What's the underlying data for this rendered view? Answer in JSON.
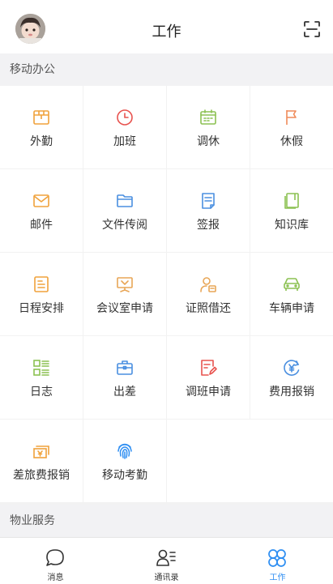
{
  "header": {
    "title": "工作",
    "avatar_icon": "child-avatar",
    "scan_icon": "scan-icon"
  },
  "sections": {
    "mobile_office": "移动办公",
    "property_service": "物业服务"
  },
  "tiles": [
    {
      "label": "外勤",
      "icon": "field-work-icon",
      "color": "#f0a23b"
    },
    {
      "label": "加班",
      "icon": "clock-icon",
      "color": "#e8534f"
    },
    {
      "label": "调休",
      "icon": "calendar-icon",
      "color": "#8cc152"
    },
    {
      "label": "休假",
      "icon": "flag-icon",
      "color": "#ef8a5a"
    },
    {
      "label": "邮件",
      "icon": "mail-icon",
      "color": "#f0a23b"
    },
    {
      "label": "文件传阅",
      "icon": "folder-icon",
      "color": "#4a8fe0"
    },
    {
      "label": "签报",
      "icon": "document-icon",
      "color": "#4a8fe0"
    },
    {
      "label": "知识库",
      "icon": "book-icon",
      "color": "#8cc152"
    },
    {
      "label": "日程安排",
      "icon": "schedule-icon",
      "color": "#f0a23b"
    },
    {
      "label": "会议室申请",
      "icon": "presentation-icon",
      "color": "#e8a657"
    },
    {
      "label": "证照借还",
      "icon": "id-card-icon",
      "color": "#e8a657"
    },
    {
      "label": "车辆申请",
      "icon": "car-icon",
      "color": "#8cc152"
    },
    {
      "label": "日志",
      "icon": "log-grid-icon",
      "color": "#8cc152"
    },
    {
      "label": "出差",
      "icon": "briefcase-icon",
      "color": "#4a8fe0"
    },
    {
      "label": "调班申请",
      "icon": "edit-form-icon",
      "color": "#e8534f"
    },
    {
      "label": "费用报销",
      "icon": "yuan-coin-icon",
      "color": "#4a8fe0"
    },
    {
      "label": "差旅费报销",
      "icon": "cash-icon",
      "color": "#f0a23b"
    },
    {
      "label": "移动考勤",
      "icon": "fingerprint-icon",
      "color": "#2e8ef2"
    }
  ],
  "tabs": [
    {
      "label": "消息",
      "icon": "chat-bubble-icon"
    },
    {
      "label": "通讯录",
      "icon": "contacts-icon"
    },
    {
      "label": "工作",
      "icon": "apps-icon",
      "active": true
    }
  ],
  "colors": {
    "accent": "#2e8ef2",
    "section_bg": "#f2f2f4"
  }
}
